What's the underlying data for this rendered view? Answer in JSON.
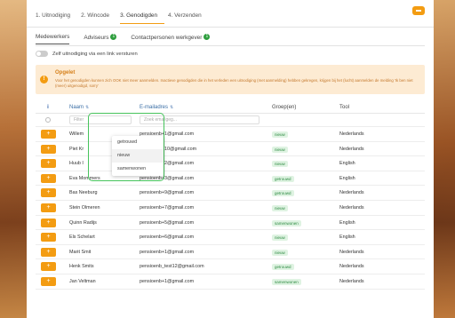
{
  "steps": [
    "1. Uitnodiging",
    "2. Wincode",
    "3. Genodigden",
    "4. Verzenden"
  ],
  "active_step": 2,
  "help_icon": "chat-icon",
  "subtabs": [
    {
      "label": "Medewerkers",
      "badge": ""
    },
    {
      "label": "Adviseurs",
      "badge": "1"
    },
    {
      "label": "Contactpersonen werkgever",
      "badge": "1"
    }
  ],
  "self_invite_label": "Zelf uitnodiging via een link versturen",
  "alert": {
    "title": "Opgelet",
    "text": "Voor het genodigden kunnen zich OOK niet meer aanmelden. Inactieve genodigden die in het verleden een uitnodiging (met aanmelding) hebben gekregen, krijgen bij het (lucht) aanmelden de melding 'Ik ben niet (meer) uitgenodigd, sorry'"
  },
  "table": {
    "headers": {
      "info": "i",
      "name": "Naam",
      "email": "E-mailadres",
      "group": "Groep(en)",
      "tool": "Tool"
    },
    "filter": {
      "name_placeholder": "Filter",
      "email_placeholder": "Zoek emailgeg..."
    },
    "rows": [
      {
        "name": "Willem",
        "email": "pensioenb+1@gmail.com",
        "group": "nieuw",
        "tool": "Nederlands"
      },
      {
        "name": "Piet Kr",
        "email": "pensioenb+10@gmail.com",
        "group": "nieuw",
        "tool": "Nederlands"
      },
      {
        "name": "Huub I",
        "email": "pensioenb+2@gmail.com",
        "group": "nieuw",
        "tool": "English"
      },
      {
        "name": "Eva Mommers",
        "email": "pensioenb+3@gmail.com",
        "group": "getrouwd",
        "tool": "English"
      },
      {
        "name": "Bas Neeburg",
        "email": "pensioenb+9@gmail.com",
        "group": "getrouwd",
        "tool": "Nederlands"
      },
      {
        "name": "Stein Olmeren",
        "email": "pensioenb+7@gmail.com",
        "group": "nieuw",
        "tool": "Nederlands"
      },
      {
        "name": "Quinn Radijs",
        "email": "pensioenb+5@gmail.com",
        "group": "samenwonen",
        "tool": "English"
      },
      {
        "name": "Els Schelart",
        "email": "pensioenb+6@gmail.com",
        "group": "nieuw",
        "tool": "English"
      },
      {
        "name": "Marit Smit",
        "email": "pensioenb+1@gmail.com",
        "group": "nieuw",
        "tool": "Nederlands"
      },
      {
        "name": "Henk Smits",
        "email": "pensioenb_test12@gmail.com",
        "group": "getrouwd",
        "tool": "Nederlands"
      },
      {
        "name": "Jan Veltman",
        "email": "pensioenb+1@gmail.com",
        "group": "samenwonen",
        "tool": "Nederlands"
      }
    ]
  },
  "dropdown": {
    "options": [
      "getrouwd",
      "nieuw",
      "samenwonen"
    ],
    "hovered": 1
  },
  "add_button_label": "+",
  "colors": {
    "accent": "#f39c12",
    "tag_bg": "#dff3e2",
    "tag_fg": "#2e8b43",
    "highlight": "#47c45c"
  }
}
